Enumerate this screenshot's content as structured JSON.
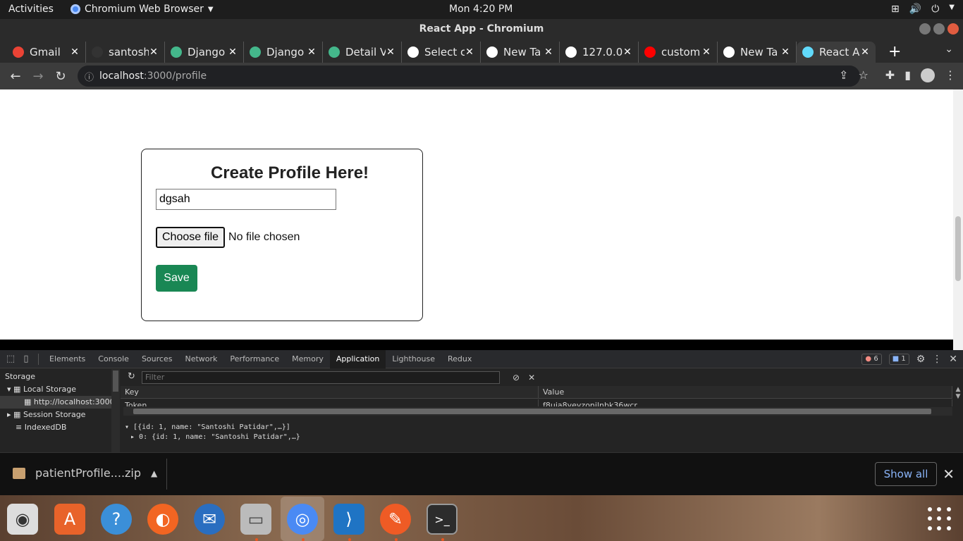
{
  "system": {
    "activities": "Activities",
    "app_name": "Chromium Web Browser",
    "clock": "Mon  4:20 PM"
  },
  "window": {
    "title": "React App - Chromium"
  },
  "tabs": [
    {
      "label": "Gmail",
      "icon": "gmail-icon",
      "color": "#ea4335"
    },
    {
      "label": "santosh",
      "icon": "github-icon",
      "color": "#333333"
    },
    {
      "label": "Django",
      "icon": "django-icon",
      "color": "#44b78b"
    },
    {
      "label": "Django",
      "icon": "django-icon",
      "color": "#44b78b"
    },
    {
      "label": "Detail V",
      "icon": "django-icon",
      "color": "#44b78b"
    },
    {
      "label": "Select c",
      "icon": "globe-icon",
      "color": "#ffffff"
    },
    {
      "label": "New Ta",
      "icon": "chromium-icon",
      "color": "#ffffff"
    },
    {
      "label": "127.0.0",
      "icon": "globe-icon",
      "color": "#ffffff"
    },
    {
      "label": "custom",
      "icon": "youtube-icon",
      "color": "#ff0000"
    },
    {
      "label": "New Ta",
      "icon": "chromium-icon",
      "color": "#ffffff"
    },
    {
      "label": "React A",
      "icon": "react-icon",
      "color": "#61dafb",
      "active": true
    }
  ],
  "address": {
    "host": "localhost",
    "path": ":3000/profile"
  },
  "form": {
    "title": "Create Profile Here!",
    "name_value": "dgsah",
    "file_button": "Choose file",
    "file_status": "No file chosen",
    "save_label": "Save",
    "save_color": "#198754"
  },
  "devtools": {
    "tabs": [
      "Elements",
      "Console",
      "Sources",
      "Network",
      "Performance",
      "Memory",
      "Application",
      "Lighthouse",
      "Redux"
    ],
    "active_tab": "Application",
    "errors": "6",
    "messages": "1",
    "filter_placeholder": "Filter",
    "sidebar": {
      "heading": "Storage",
      "local_storage": "Local Storage",
      "local_origin": "http://localhost:3000",
      "session_storage": "Session Storage",
      "indexeddb": "IndexedDB"
    },
    "table": {
      "key_header": "Key",
      "value_header": "Value",
      "row_key": "Token",
      "row_value": "f8uja8yeyzonilnbk36wcr"
    },
    "preview_line1": "[{id: 1, name: \"Santoshi Patidar\",…}]",
    "preview_line2": "0: {id: 1, name: \"Santoshi Patidar\",…}"
  },
  "download": {
    "file": "patientProfile....zip",
    "show_all": "Show all"
  },
  "dock": [
    "rhythmbox-icon",
    "software-icon",
    "help-icon",
    "firefox-icon",
    "thunderbird-icon",
    "files-icon",
    "chromium-icon",
    "vscode-icon",
    "postman-icon",
    "terminal-icon"
  ]
}
